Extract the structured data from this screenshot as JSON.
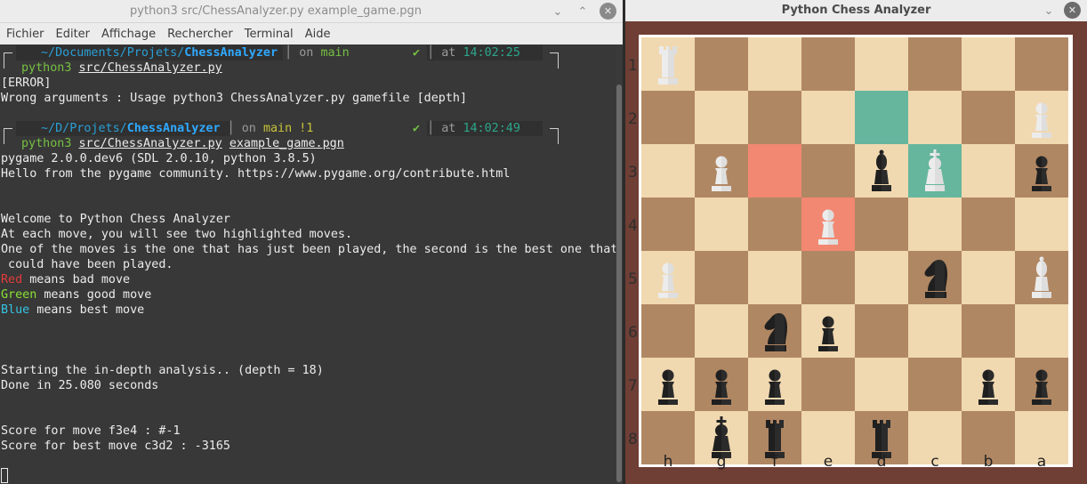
{
  "terminal": {
    "title": "python3 src/ChessAnalyzer.py example_game.pgn",
    "controls": {
      "minimize": "⌄",
      "maximize": "⌃",
      "close": "✕"
    },
    "menu": [
      "Fichier",
      "Editer",
      "Affichage",
      "Rechercher",
      "Terminal",
      "Aide"
    ],
    "prompt1": {
      "path_prefix": "~/Documents/Projets/",
      "path_dir": "ChessAnalyzer",
      "branch_label": "on",
      "branch": "main",
      "check": "✔",
      "time_label": "at",
      "time": "14:02:25",
      "cmd_prog": "python3",
      "cmd_arg1": "src/ChessAnalyzer.py",
      "cmd_arg2": ""
    },
    "output1": [
      "[ERROR]",
      "Wrong arguments : Usage python3 ChessAnalyzer.py gamefile [depth]"
    ],
    "prompt2": {
      "path_prefix": "~/D/Projets/",
      "path_dir": "ChessAnalyzer",
      "branch_label": "on",
      "branch": "main !1",
      "check": "✔",
      "time_label": "at",
      "time": "14:02:49",
      "cmd_prog": "python3",
      "cmd_arg1": "src/ChessAnalyzer.py",
      "cmd_arg2": "example_game.pgn"
    },
    "output2": [
      "pygame 2.0.0.dev6 (SDL 2.0.10, python 3.8.5)",
      "Hello from the pygame community. https://www.pygame.org/contribute.html",
      "Welcome to Python Chess Analyzer",
      "At each move, you will see two highlighted moves.",
      "One of the moves is the one that has just been played, the second is the best one that",
      " could have been played."
    ],
    "legend": [
      {
        "word": "Red",
        "rest": " means bad move",
        "color": "#e23b3b"
      },
      {
        "word": "Green",
        "rest": " means good move",
        "color": "#8ae234"
      },
      {
        "word": "Blue",
        "rest": " means best move",
        "color": "#34c3e2"
      }
    ],
    "output3": [
      "Starting the in-depth analysis.. (depth = 18)",
      "Done in 25.080 seconds",
      "Score for move f3e4 : #-1",
      "Score for best move c3d2 : -3165"
    ]
  },
  "chess": {
    "title": "Python Chess Analyzer",
    "controls": {
      "minimize": "⌄",
      "close": "✕"
    },
    "ranks": [
      "1",
      "2",
      "3",
      "4",
      "5",
      "6",
      "7",
      "8"
    ],
    "files": [
      "h",
      "g",
      "f",
      "e",
      "d",
      "c",
      "b",
      "a"
    ],
    "colors": {
      "light": "#f0d8b0",
      "dark": "#b08763",
      "good": "#66b69d",
      "bad": "#f28872",
      "frame": "#6f3e35"
    },
    "board": [
      [
        "wR",
        "",
        "",
        "",
        "",
        "",
        "",
        ""
      ],
      [
        "",
        "",
        "",
        "",
        "",
        "",
        "",
        "wP"
      ],
      [
        "",
        "wP",
        "",
        "",
        "bB",
        "wK",
        "",
        "bP"
      ],
      [
        "",
        "",
        "",
        "wP",
        "",
        "",
        "",
        ""
      ],
      [
        "wP",
        "",
        "",
        "",
        "",
        "bN",
        "",
        "wB"
      ],
      [
        "",
        "",
        "bN",
        "bP",
        "",
        "",
        "",
        ""
      ],
      [
        "bP",
        "bP",
        "bP",
        "",
        "",
        "",
        "bP",
        "bP"
      ],
      [
        "",
        "bK",
        "bR",
        "",
        "bR",
        "",
        "",
        ""
      ]
    ],
    "highlights": [
      {
        "rank": "2",
        "file": "d",
        "kind": "good"
      },
      {
        "rank": "3",
        "file": "c",
        "kind": "good"
      },
      {
        "rank": "3",
        "file": "f",
        "kind": "bad"
      },
      {
        "rank": "4",
        "file": "e",
        "kind": "bad"
      }
    ]
  }
}
